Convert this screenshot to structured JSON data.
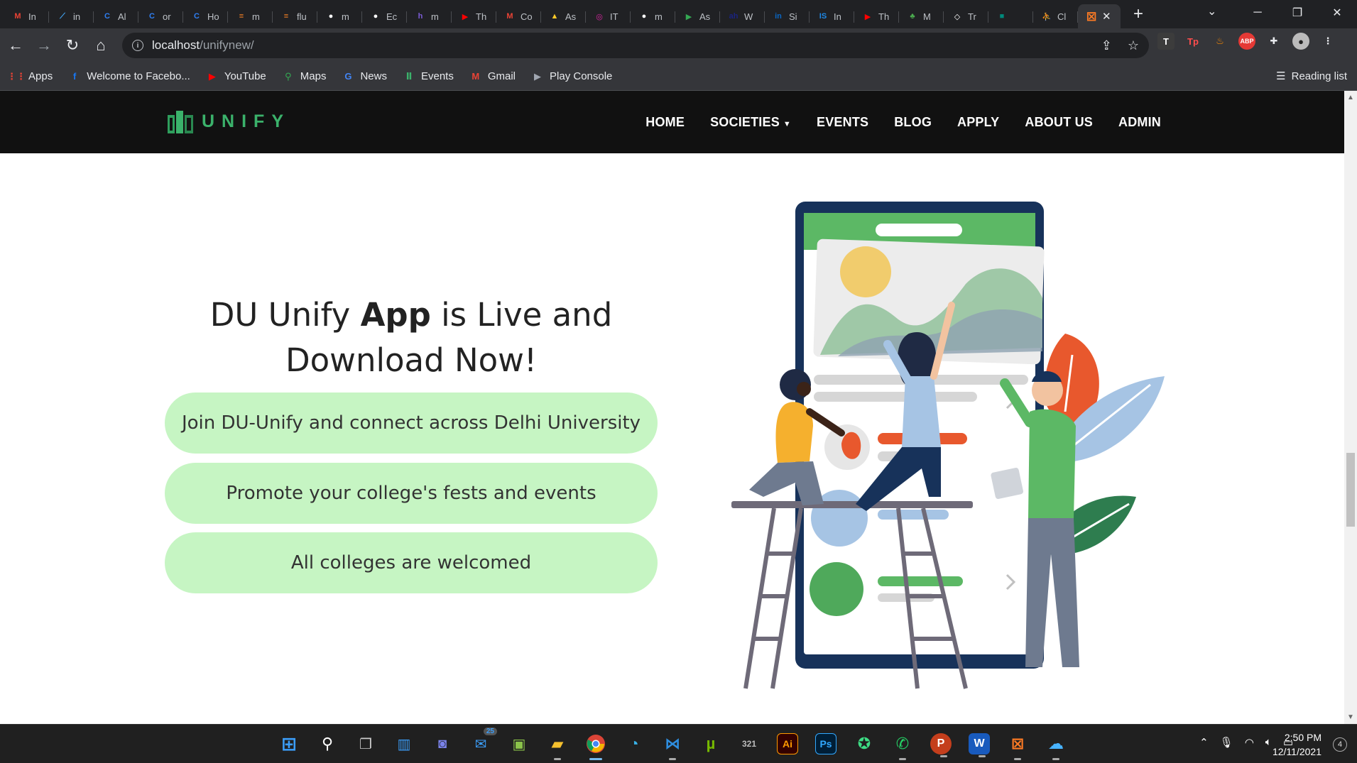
{
  "browser": {
    "tabs": [
      {
        "label": "In",
        "icon": "gmail-icon",
        "color": "#ea4335",
        "glyph": "M"
      },
      {
        "label": "in",
        "icon": "flutter-icon",
        "color": "#42a5f5",
        "glyph": "⟋"
      },
      {
        "label": "Al",
        "icon": "canva-icon",
        "color": "#2f7ff2",
        "glyph": "C"
      },
      {
        "label": "or",
        "icon": "canva-icon",
        "color": "#2f7ff2",
        "glyph": "C"
      },
      {
        "label": "Ho",
        "icon": "canva-icon",
        "color": "#2f7ff2",
        "glyph": "C"
      },
      {
        "label": "m",
        "icon": "stackoverflow-icon",
        "color": "#f48024",
        "glyph": "≡"
      },
      {
        "label": "flu",
        "icon": "stackoverflow-icon",
        "color": "#f48024",
        "glyph": "≡"
      },
      {
        "label": "m",
        "icon": "github-icon",
        "color": "#ffffff",
        "glyph": "●"
      },
      {
        "label": "Ec",
        "icon": "github-icon",
        "color": "#ffffff",
        "glyph": "●"
      },
      {
        "label": "m",
        "icon": "h-icon",
        "color": "#7b5cd6",
        "glyph": "h"
      },
      {
        "label": "Th",
        "icon": "youtube-icon",
        "color": "#ff0000",
        "glyph": "▶"
      },
      {
        "label": "Co",
        "icon": "gmail-icon",
        "color": "#ea4335",
        "glyph": "M"
      },
      {
        "label": "As",
        "icon": "firebase-icon",
        "color": "#ffca28",
        "glyph": "▲"
      },
      {
        "label": "IT",
        "icon": "instagram-icon",
        "color": "#d6249f",
        "glyph": "◎"
      },
      {
        "label": "m",
        "icon": "github-icon",
        "color": "#ffffff",
        "glyph": "●"
      },
      {
        "label": "As",
        "icon": "play-icon",
        "color": "#34a853",
        "glyph": "▶"
      },
      {
        "label": "W",
        "icon": "wh-icon",
        "color": "#1a237e",
        "glyph": "ah"
      },
      {
        "label": "Si",
        "icon": "linkedin-icon",
        "color": "#0a66c2",
        "glyph": "in"
      },
      {
        "label": "In",
        "icon": "is-icon",
        "color": "#1e88e5",
        "glyph": "IS"
      },
      {
        "label": "Th",
        "icon": "youtube-icon",
        "color": "#ff0000",
        "glyph": "▶"
      },
      {
        "label": "M",
        "icon": "leaf-icon",
        "color": "#4caf50",
        "glyph": "♣"
      },
      {
        "label": "Tr",
        "icon": "codepen-icon",
        "color": "#ffffff",
        "glyph": "◇"
      },
      {
        "label": "",
        "icon": "meet-icon",
        "color": "#00897b",
        "glyph": "■"
      },
      {
        "label": "Cl",
        "icon": "figure-icon",
        "color": "#ef6c00",
        "glyph": "⛹"
      }
    ],
    "active_tab": {
      "icon": "xampp-icon",
      "color": "#fb7a24",
      "glyph": "⊠"
    },
    "address": {
      "host": "localhost",
      "path": "/unifynew/"
    },
    "bookmarks": [
      {
        "label": "Apps",
        "icon": "apps-grid-icon",
        "color": "#ea4335",
        "glyph": "⋮⋮"
      },
      {
        "label": "Welcome to Facebo...",
        "icon": "facebook-icon",
        "color": "#1877f2",
        "glyph": "f"
      },
      {
        "label": "YouTube",
        "icon": "youtube-icon",
        "color": "#ff0000",
        "glyph": "▶"
      },
      {
        "label": "Maps",
        "icon": "maps-icon",
        "color": "#34a853",
        "glyph": "⚲"
      },
      {
        "label": "News",
        "icon": "news-icon",
        "color": "#4285f4",
        "glyph": "G"
      },
      {
        "label": "Events",
        "icon": "events-icon",
        "color": "#3bb26b",
        "glyph": "Ⅱ"
      },
      {
        "label": "Gmail",
        "icon": "gmail-icon",
        "color": "#ea4335",
        "glyph": "M"
      },
      {
        "label": "Play Console",
        "icon": "play-console-icon",
        "color": "#a0a6b0",
        "glyph": "▶"
      }
    ],
    "reading_list": "Reading list"
  },
  "site": {
    "logo_text": "UNIFY",
    "menu": [
      "HOME",
      "SOCIETIES",
      "EVENTS",
      "BLOG",
      "APPLY",
      "ABOUT US",
      "ADMIN"
    ],
    "hero": {
      "pre": "DU Unify ",
      "bold": "App",
      "post": " is Live and Download Now!"
    },
    "pills": [
      "Join DU-Unify and connect across Delhi University",
      "Promote your college's fests and events",
      "All colleges are welcomed"
    ]
  },
  "taskbar": {
    "mail_badge": "25",
    "time": "2:50 PM",
    "date": "12/11/2021",
    "notifications": "4"
  }
}
